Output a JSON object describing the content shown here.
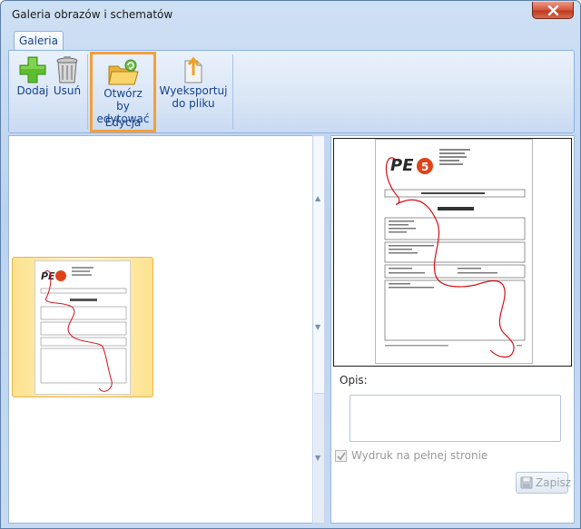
{
  "window": {
    "title": "Galeria obrazów i schematów",
    "accent": "#f49f3a",
    "close_color": "#c0391f"
  },
  "ribbon": {
    "tab_label": "Galeria",
    "buttons": {
      "dodaj": {
        "label": "Dodaj",
        "icon": "plus-icon"
      },
      "usun": {
        "label": "Usuń",
        "icon": "trash-icon"
      },
      "otworz": {
        "label": "Otwórz by edytować",
        "icon": "open-folder-icon"
      },
      "wyeksportuj": {
        "label": "Wyeksportuj do pliku",
        "icon": "export-icon"
      }
    },
    "group_label": "Edycja"
  },
  "preview_doc": {
    "header_text": "Protokół przekazania uszkodzenia",
    "doc_number": "RAP - 0006 - 2011"
  },
  "details": {
    "opis_label": "Opis:",
    "opis_value": "",
    "wydruk_label": "Wydruk na pełnej stronie",
    "wydruk_checked": true,
    "zapisz_label": "Zapisz"
  }
}
